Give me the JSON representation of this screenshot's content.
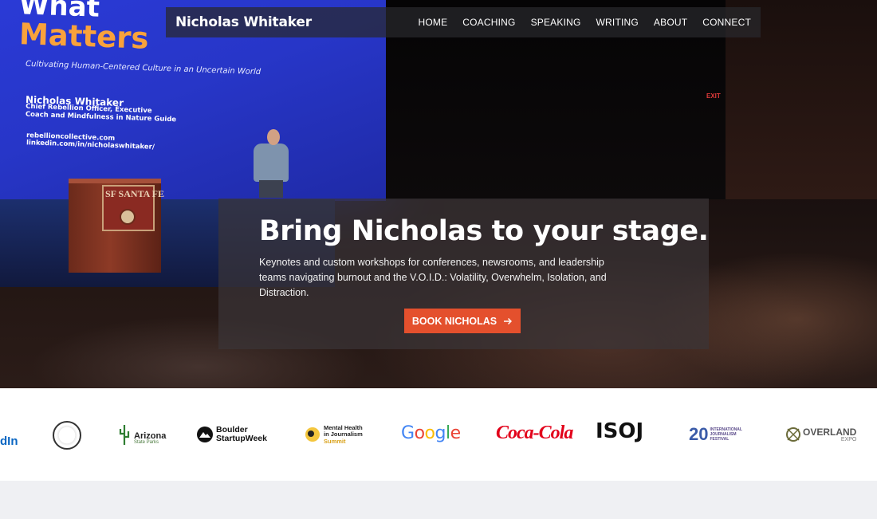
{
  "screen": {
    "title_line1": "What",
    "title_line2": "Matters",
    "subtitle": "Cultivating Human-Centered Culture in an Uncertain World",
    "name": "Nicholas Whitaker",
    "role": "Chief Rebellion Officer, Executive Coach and Mindfulness in Nature Guide",
    "link1": "rebellioncollective.com",
    "link2": "linkedin.com/in/nicholaswhitaker/",
    "exit_sign": "EXIT",
    "podium_text": "SF SANTA FE"
  },
  "nav": {
    "brand": "Nicholas Whitaker",
    "links": [
      "HOME",
      "COACHING",
      "SPEAKING",
      "WRITING",
      "ABOUT",
      "CONNECT"
    ]
  },
  "cta": {
    "title": "Bring Nicholas to your stage.",
    "body": "Keynotes and custom workshops for conferences, newsrooms, and leadership teams navigating burnout and the V.O.I.D.: Volatility, Overwhelm, Isolation, and Distraction.",
    "button_label": "BOOK NICHOLAS",
    "button_color": "#e4502d"
  },
  "logos": {
    "linkedin": "dIn",
    "arizona_name": "Arizona",
    "arizona_sub": "State Parks",
    "boulder_line1": "Boulder",
    "boulder_line2": "StartupWeek",
    "mental_line1": "Mental Health",
    "mental_line2": "in Journalism",
    "mental_line3": "Summit",
    "google": "Google",
    "coke": "Coca-Cola",
    "isoj": "ISOJ",
    "ijf_num": "20",
    "ijf_text": "INTERNATIONAL JOURNALISM FESTIVAL",
    "overland_name": "OVERLAND",
    "overland_sub": "EXPO"
  }
}
